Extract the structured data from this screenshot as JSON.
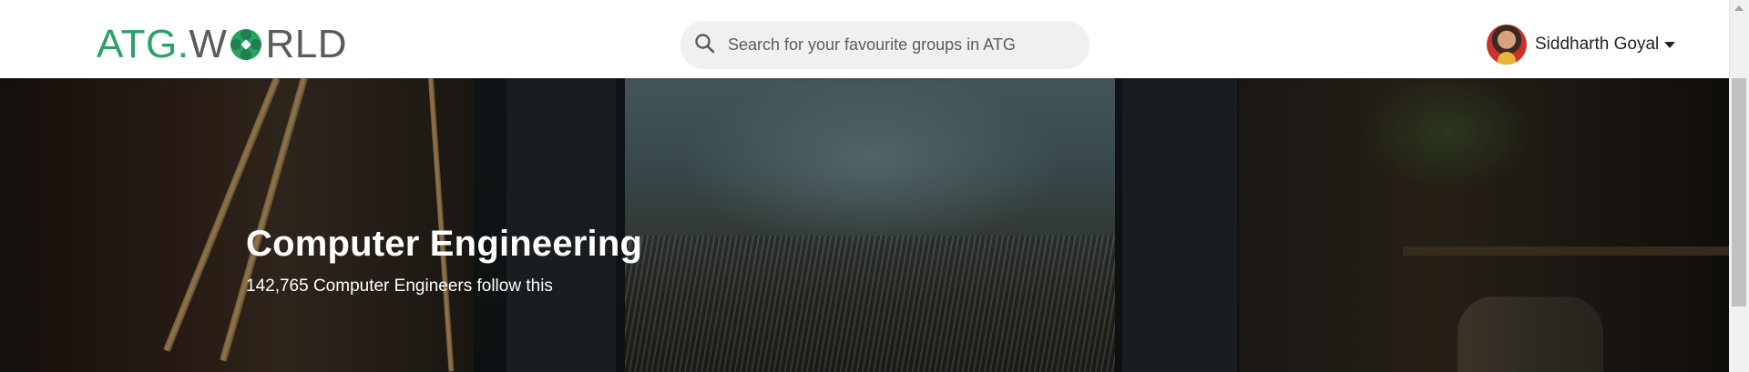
{
  "navbar": {
    "logo": {
      "part_atg": "ATG",
      "part_dot": ".",
      "part_w": "W",
      "part_rld": "RLD",
      "brand_green": "#27a365",
      "brand_gray": "#5b5b5b",
      "icon": "clover-icon"
    },
    "search": {
      "placeholder": "Search for your favourite groups in ATG",
      "value": "",
      "icon": "search-icon"
    },
    "user": {
      "name": "Siddharth Goyal",
      "icon": "caret-down-icon"
    }
  },
  "banner": {
    "title": "Computer Engineering",
    "subtitle": "142,765 Computer Engineers follow this"
  }
}
